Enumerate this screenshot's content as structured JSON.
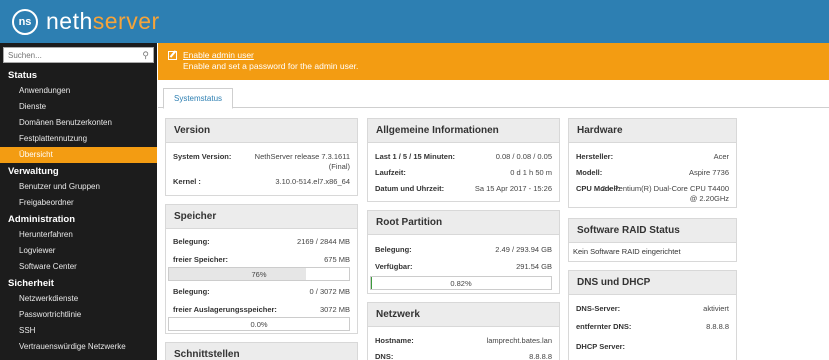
{
  "brand": {
    "mark": "ns",
    "name_part1": "neth",
    "name_part2": "server"
  },
  "search": {
    "placeholder": "Suchen..."
  },
  "sidebar": {
    "sections": [
      {
        "title": "Status",
        "items": [
          "Anwendungen",
          "Dienste",
          "Domänen Benutzerkonten",
          "Festplattennutzung",
          "Übersicht"
        ]
      },
      {
        "title": "Verwaltung",
        "items": [
          "Benutzer und Gruppen",
          "Freigabeordner"
        ]
      },
      {
        "title": "Administration",
        "items": [
          "Herunterfahren",
          "Logviewer",
          "Software Center"
        ]
      },
      {
        "title": "Sicherheit",
        "items": [
          "Netzwerkdienste",
          "Passwortrichtlinie",
          "SSH",
          "Vertrauenswürdige Netzwerke"
        ]
      }
    ],
    "active_item": "Übersicht"
  },
  "notice": {
    "link": "Enable admin user",
    "text": "Enable and set a password for the admin user."
  },
  "tabs": {
    "active": "Systemstatus"
  },
  "version": {
    "title": "Version",
    "system_label": "System Version:",
    "system_value_1": "NethServer release 7.3.1611",
    "system_value_2": "(Final)",
    "kernel_label": "Kernel :",
    "kernel_value": "3.10.0-514.el7.x86_64"
  },
  "speicher": {
    "title": "Speicher",
    "belegung_label": "Belegung:",
    "belegung_value": "2169 / 2844 MB",
    "frei_label": "freier Speicher:",
    "frei_value": "675 MB",
    "frei_percent_label": "76%",
    "frei_fraction": 0.76,
    "swap_label": "Belegung:",
    "swap_value": "0 / 3072 MB",
    "swap_frei_label": "freier Auslagerungsspeicher:",
    "swap_frei_value": "3072 MB",
    "swap_percent_label": "0.0%",
    "swap_fraction": 0.0
  },
  "schnitt": {
    "title": "Schnittstellen"
  },
  "allgemein": {
    "title": "Allgemeine Informationen",
    "load_label": "Last 1 / 5 / 15 Minuten:",
    "load_value": "0.08 / 0.08 / 0.05",
    "lauf_label": "Laufzeit:",
    "lauf_value": "0 d 1 h 50 m",
    "datum_label": "Datum und Uhrzeit:",
    "datum_value": "Sa 15 Apr 2017 - 15:26"
  },
  "root": {
    "title": "Root Partition",
    "belegung_label": "Belegung:",
    "belegung_value": "2.49 / 293.94 GB",
    "verf_label": "Verfügbar:",
    "verf_value": "291.54 GB",
    "percent_label": "0.82%",
    "fraction": 0.0082
  },
  "netzwerk": {
    "title": "Netzwerk",
    "host_label": "Hostname:",
    "host_value": "lamprecht.bates.lan",
    "dns_label": "DNS:",
    "dns_value": "8.8.8.8"
  },
  "hardware": {
    "title": "Hardware",
    "hersteller_label": "Hersteller:",
    "hersteller_value": "Acer",
    "modell_label": "Modell:",
    "modell_value": "Aspire 7736",
    "cpu_label": "CPU Modell:",
    "cpu_value_1": "2 x Pentium(R) Dual-Core CPU T4400",
    "cpu_value_2": "@ 2.20GHz"
  },
  "raid": {
    "title": "Software RAID Status",
    "text": "Kein Software RAID eingerichtet"
  },
  "dns_dhcp": {
    "title": "DNS und DHCP",
    "dns_label": "DNS-Server:",
    "dns_value": "aktiviert",
    "remote_label": "entfernter DNS:",
    "remote_value": "8.8.8.8",
    "dhcp_label": "DHCP Server:"
  }
}
